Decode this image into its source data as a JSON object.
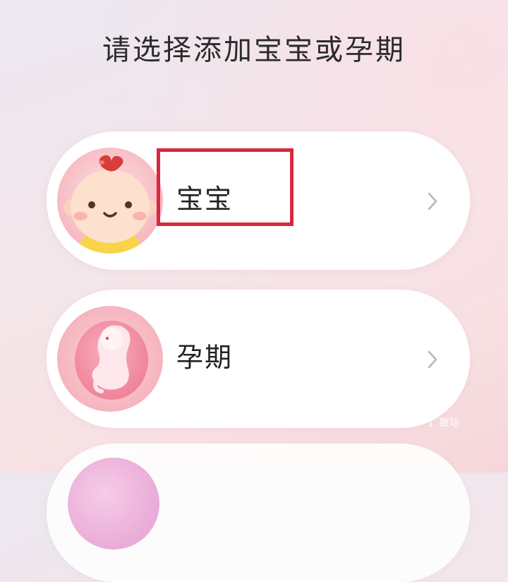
{
  "header": {
    "title": "请选择添加宝宝或孕期"
  },
  "options": [
    {
      "label": "宝宝",
      "icon": "baby-face-icon"
    },
    {
      "label": "孕期",
      "icon": "fetus-icon"
    }
  ],
  "watermark": "丁 致站",
  "colors": {
    "highlight": "#d8283f",
    "accent_pink": "#f0889b",
    "card": "#ffffff"
  }
}
